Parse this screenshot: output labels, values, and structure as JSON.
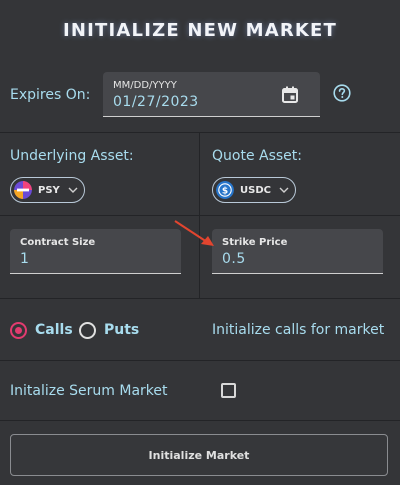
{
  "header": {
    "title": "INITIALIZE NEW MARKET"
  },
  "expires": {
    "label": "Expires On:",
    "placeholder": "MM/DD/YYYY",
    "value": "01/27/2023",
    "calendar_icon": "calendar-icon",
    "help_icon": "help-circle-icon"
  },
  "underlying": {
    "label": "Underlying Asset:",
    "token": "PSY",
    "icon": "psy-token-icon"
  },
  "quote": {
    "label": "Quote Asset:",
    "token": "USDC",
    "icon": "usdc-token-icon"
  },
  "contract_size": {
    "label": "Contract Size",
    "value": "1"
  },
  "strike_price": {
    "label": "Strike Price",
    "value": "0.5"
  },
  "option_type": {
    "calls_label": "Calls",
    "puts_label": "Puts",
    "selected": "Calls",
    "info_text": "Initialize calls for market"
  },
  "serum": {
    "label": "Initalize Serum Market",
    "checked": false
  },
  "submit": {
    "label": "Initialize Market"
  },
  "colors": {
    "accent": "#a8dcee",
    "radio_selected": "#e23b6f",
    "annotation_arrow": "#e2452f"
  }
}
